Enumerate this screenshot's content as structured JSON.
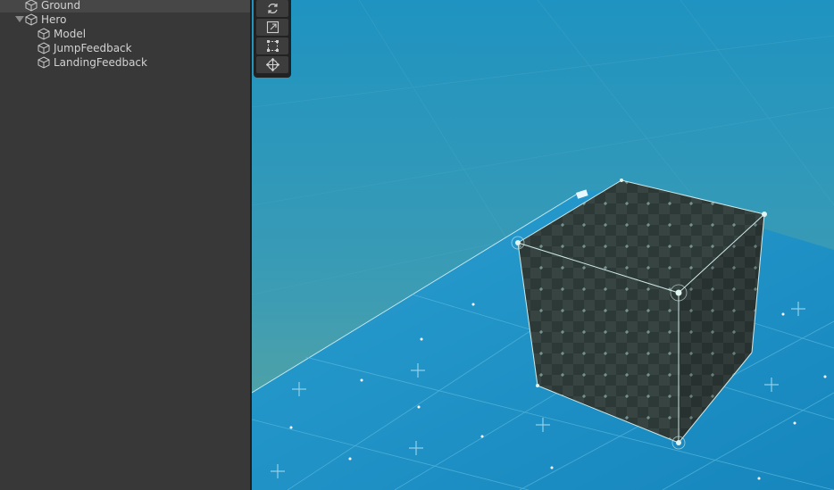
{
  "hierarchy": {
    "items": [
      {
        "label": "Ground",
        "icon": "cube-icon"
      },
      {
        "label": "Hero",
        "icon": "cube-icon",
        "expanded": true
      },
      {
        "label": "Model",
        "icon": "cube-icon"
      },
      {
        "label": "JumpFeedback",
        "icon": "cube-icon"
      },
      {
        "label": "LandingFeedback",
        "icon": "cube-icon"
      }
    ]
  },
  "toolbar": {
    "tools": [
      "rotate-tool-icon",
      "scale-tool-icon",
      "rect-tool-icon",
      "transform-tool-icon"
    ]
  },
  "colors": {
    "panel_bg": "#383838",
    "selected_row": "#474747",
    "text": "#d2d2d2",
    "ground_blue": "#1a8bbf",
    "sky_blue": "#2a93b8",
    "cube_dark": "#3a4a48"
  }
}
